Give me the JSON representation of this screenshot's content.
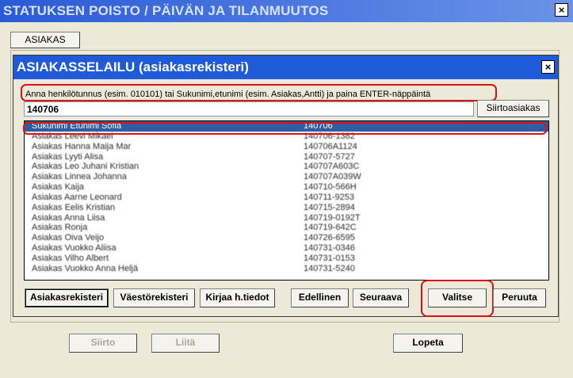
{
  "window": {
    "title": "STATUKSEN POISTO / PÄIVÄN JA TILANMUUTOS",
    "close": "×"
  },
  "top_tab": {
    "label": "ASIAKAS"
  },
  "dialog": {
    "title": "ASIAKASSELAILU (asiakasrekisteri)",
    "close": "×",
    "instruction": "Anna henkilötunnus (esim. 010101) tai Sukunimi,etunimi (esim. Asiakas,Antti) ja paina ENTER-näppäintä",
    "search_value": "140706",
    "transfer_button": "Siirtoasiakas",
    "results": [
      {
        "name": "Sukunimi Etunimi Sofia",
        "id": "140706"
      },
      {
        "name": "Asiakas Leevi Mikael",
        "id": "140706-1382"
      },
      {
        "name": "Asiakas Hanna Maija Mar",
        "id": "140706A1124"
      },
      {
        "name": "Asiakas Lyyti Alisa",
        "id": "140707-5727"
      },
      {
        "name": "Asiakas Leo Juhani Kristian",
        "id": "140707A603C"
      },
      {
        "name": "Asiakas Linnea Johanna",
        "id": "140707A039W"
      },
      {
        "name": "Asiakas Kaija",
        "id": "140710-566H"
      },
      {
        "name": "Asiakas Aarne Leonard",
        "id": "140711-9253"
      },
      {
        "name": "Asiakas Eelis Kristian",
        "id": "140715-2894"
      },
      {
        "name": "Asiakas Anna Liisa",
        "id": "140719-0192T"
      },
      {
        "name": "Asiakas Ronja",
        "id": "140719-642C"
      },
      {
        "name": "Asiakas Oiva Veijo",
        "id": "140726-6595"
      },
      {
        "name": "Asiakas Vuokko Aliisa",
        "id": "140731-0346"
      },
      {
        "name": "Asiakas Vilho Albert",
        "id": "140731-0153"
      },
      {
        "name": "Asiakas Vuokko Anna Heljä",
        "id": "140731-5240"
      }
    ],
    "buttons": {
      "customer_registry": "Asiakasrekisteri",
      "population_registry": "Väestörekisteri",
      "write_info": "Kirjaa h.tiedot",
      "previous": "Edellinen",
      "next": "Seuraava",
      "select": "Valitse",
      "cancel": "Peruuta"
    }
  },
  "bottom_buttons": {
    "move": "Siirto",
    "attach": "Liitä",
    "quit": "Lopeta"
  },
  "colors": {
    "titlebar": "#1f5bd9",
    "selection": "#2f5da3",
    "highlight_ring": "#dd1111",
    "background": "#ece9d8"
  }
}
